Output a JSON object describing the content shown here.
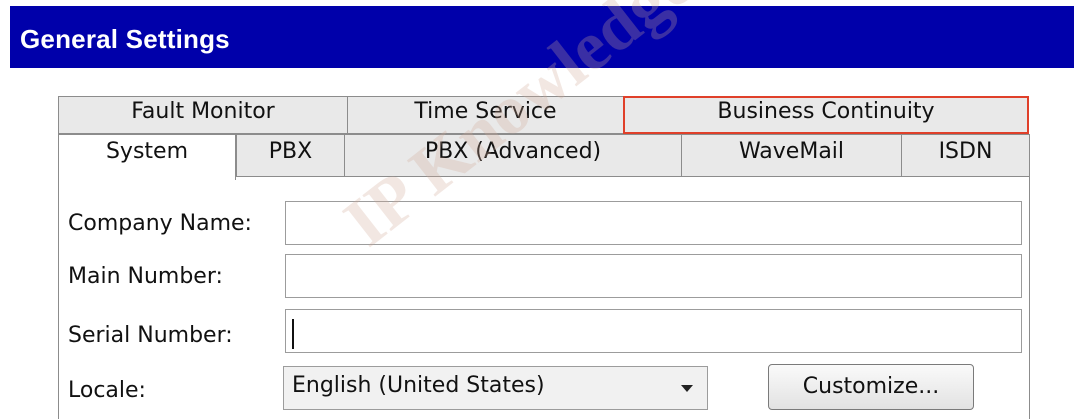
{
  "window": {
    "title": "General Settings"
  },
  "tabs": {
    "row1": [
      {
        "label": "Fault Monitor"
      },
      {
        "label": "Time Service"
      },
      {
        "label": "Business Continuity"
      }
    ],
    "row2": [
      {
        "label": "System",
        "active": true
      },
      {
        "label": "PBX"
      },
      {
        "label": "PBX (Advanced)"
      },
      {
        "label": "WaveMail"
      },
      {
        "label": "ISDN"
      }
    ]
  },
  "form": {
    "company_name": {
      "label": "Company Name:",
      "value": ""
    },
    "main_number": {
      "label": "Main Number:",
      "value": ""
    },
    "serial_number": {
      "label": "Serial Number:",
      "value": ""
    },
    "locale": {
      "label": "Locale:",
      "value": "English (United States)"
    },
    "customize_label": "Customize..."
  },
  "watermark": "IP Knowledge Ba",
  "colors": {
    "titlebar": "#0000aa",
    "highlight": "#e0402a"
  }
}
